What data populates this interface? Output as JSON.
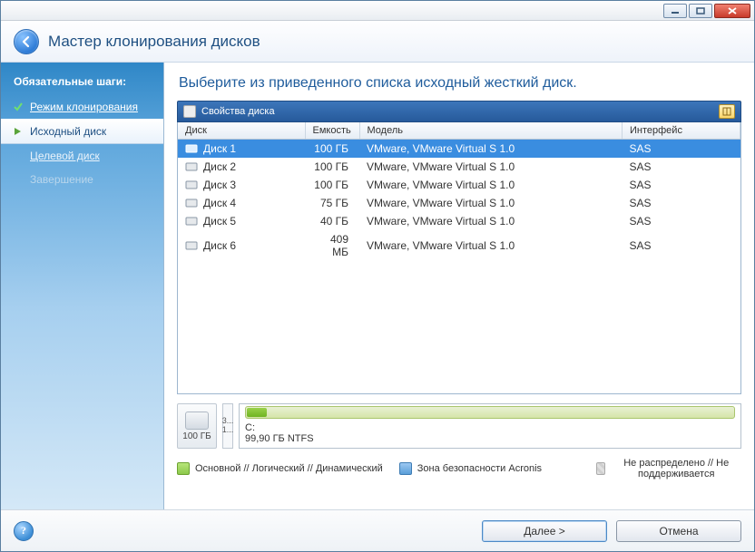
{
  "window": {
    "title": "Мастер клонирования дисков"
  },
  "sidebar": {
    "heading": "Обязательные шаги:",
    "steps": [
      {
        "label": "Режим клонирования",
        "state": "done"
      },
      {
        "label": "Исходный диск",
        "state": "current"
      },
      {
        "label": "Целевой диск",
        "state": "pending"
      },
      {
        "label": "Завершение",
        "state": "disabled"
      }
    ]
  },
  "main": {
    "instruction": "Выберите из приведенного списка исходный жесткий диск.",
    "toolbar_label": "Свойства диска",
    "columns": {
      "disk": "Диск",
      "capacity": "Емкость",
      "model": "Модель",
      "interface": "Интерфейс"
    },
    "disks": [
      {
        "name": "Диск 1",
        "capacity": "100 ГБ",
        "model": "VMware, VMware Virtual S 1.0",
        "interface": "SAS",
        "selected": true
      },
      {
        "name": "Диск 2",
        "capacity": "100 ГБ",
        "model": "VMware, VMware Virtual S 1.0",
        "interface": "SAS",
        "selected": false
      },
      {
        "name": "Диск 3",
        "capacity": "100 ГБ",
        "model": "VMware, VMware Virtual S 1.0",
        "interface": "SAS",
        "selected": false
      },
      {
        "name": "Диск 4",
        "capacity": "75 ГБ",
        "model": "VMware, VMware Virtual S 1.0",
        "interface": "SAS",
        "selected": false
      },
      {
        "name": "Диск 5",
        "capacity": "40 ГБ",
        "model": "VMware, VMware Virtual S 1.0",
        "interface": "SAS",
        "selected": false
      },
      {
        "name": "Диск 6",
        "capacity": "409 МБ",
        "model": "VMware, VMware Virtual S 1.0",
        "interface": "SAS",
        "selected": false
      }
    ],
    "partition": {
      "disk_size": "100 ГБ",
      "small_top": "3...",
      "small_bottom": "1...",
      "volume_label": "C:",
      "volume_info": "99,90 ГБ  NTFS"
    },
    "legend": {
      "primary": "Основной // Логический // Динамический",
      "zone": "Зона безопасности Acronis",
      "unallocated": "Не распределено // Не поддерживается"
    }
  },
  "footer": {
    "next": "Далее >",
    "cancel": "Отмена"
  }
}
